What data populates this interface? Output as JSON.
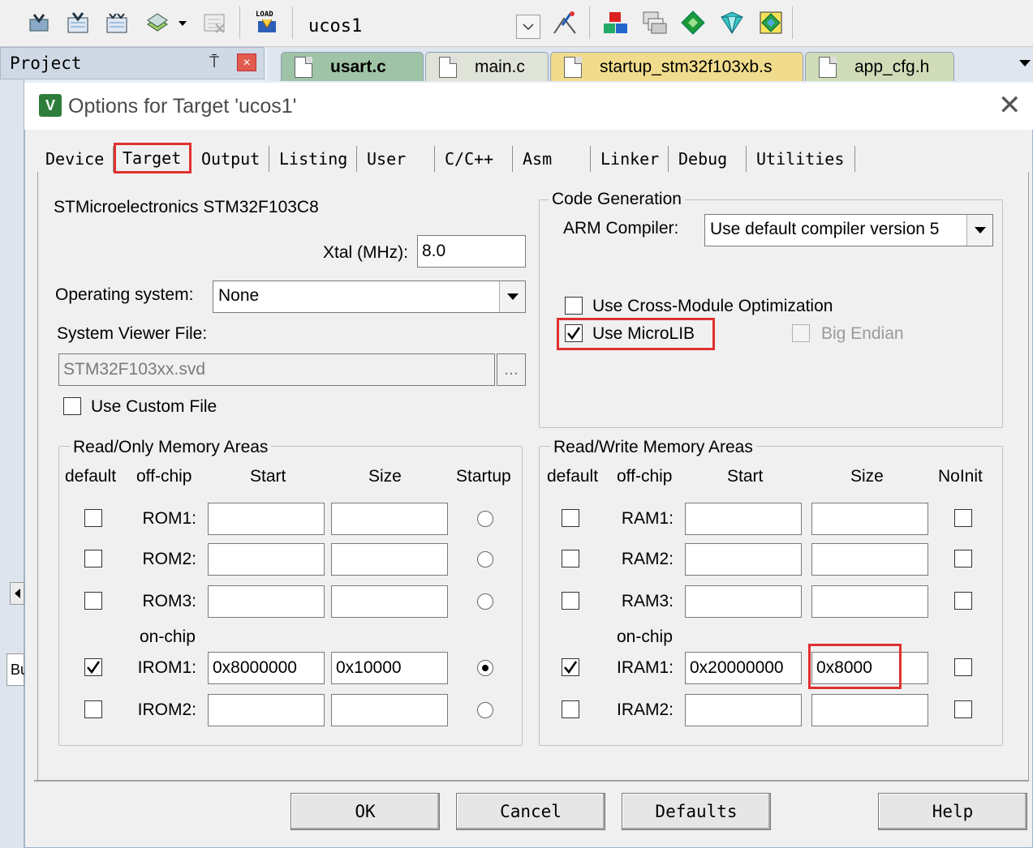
{
  "toolbar": {
    "target_name": "ucos1",
    "load_label": "LOAD",
    "icons": [
      "translate-icon",
      "build-icon",
      "rebuild-icon",
      "batch-build-icon",
      "stop-build-icon",
      "download-icon",
      "target-options-icon",
      "manage-components-icon",
      "file-extensions-icon",
      "select-packs-icon",
      "pack-installer-icon",
      "event-recorder-icon"
    ]
  },
  "project_pane": {
    "title": "Project",
    "pin_glyph": "⍑",
    "close_glyph": "×"
  },
  "editor_tabs": [
    {
      "label": "usart.c",
      "active": true,
      "color": "#9fc3a6"
    },
    {
      "label": "main.c",
      "active": false,
      "color": "#dfe3d8"
    },
    {
      "label": "startup_stm32f103xb.s",
      "active": false,
      "color": "#f0dc8c"
    },
    {
      "label": "app_cfg.h",
      "active": false,
      "color": "#d0dcb8"
    }
  ],
  "dialog": {
    "title": "Options for Target 'ucos1'",
    "icon_text": "V",
    "close_glyph": "✕",
    "tabs": [
      "Device",
      "Target",
      "Output",
      "Listing",
      "User",
      "C/C++",
      "Asm",
      "Linker",
      "Debug",
      "Utilities"
    ],
    "active_tab": "Target",
    "device_name": "STMicroelectronics STM32F103C8",
    "xtal": {
      "label": "Xtal (MHz):",
      "value": "8.0"
    },
    "os": {
      "label": "Operating system:",
      "value": "None"
    },
    "svd": {
      "label": "System Viewer File:",
      "value": "STM32F103xx.svd",
      "browse": "..."
    },
    "use_custom_file": {
      "label": "Use Custom File",
      "checked": false
    },
    "code_gen": {
      "title": "Code Generation",
      "compiler_label": "ARM Compiler:",
      "compiler_value": "Use default compiler version 5",
      "cross_module": {
        "label": "Use Cross-Module Optimization",
        "checked": false
      },
      "microlib": {
        "label": "Use MicroLIB",
        "checked": true
      },
      "big_endian": {
        "label": "Big Endian",
        "checked": false,
        "enabled": false
      }
    },
    "ro_memory": {
      "title": "Read/Only Memory Areas",
      "headers": {
        "default": "default",
        "offchip": "off-chip",
        "start": "Start",
        "size": "Size",
        "startup": "Startup"
      },
      "onchip_label": "on-chip",
      "rows": [
        {
          "name": "ROM1:",
          "default": false,
          "start": "",
          "size": "",
          "startup": false
        },
        {
          "name": "ROM2:",
          "default": false,
          "start": "",
          "size": "",
          "startup": false
        },
        {
          "name": "ROM3:",
          "default": false,
          "start": "",
          "size": "",
          "startup": false
        },
        {
          "name": "IROM1:",
          "default": true,
          "start": "0x8000000",
          "size": "0x10000",
          "startup": true
        },
        {
          "name": "IROM2:",
          "default": false,
          "start": "",
          "size": "",
          "startup": false
        }
      ]
    },
    "rw_memory": {
      "title": "Read/Write Memory Areas",
      "headers": {
        "default": "default",
        "offchip": "off-chip",
        "start": "Start",
        "size": "Size",
        "noinit": "NoInit"
      },
      "onchip_label": "on-chip",
      "rows": [
        {
          "name": "RAM1:",
          "default": false,
          "start": "",
          "size": "",
          "noinit": false
        },
        {
          "name": "RAM2:",
          "default": false,
          "start": "",
          "size": "",
          "noinit": false
        },
        {
          "name": "RAM3:",
          "default": false,
          "start": "",
          "size": "",
          "noinit": false
        },
        {
          "name": "IRAM1:",
          "default": true,
          "start": "0x20000000",
          "size": "0x8000",
          "noinit": false
        },
        {
          "name": "IRAM2:",
          "default": false,
          "start": "",
          "size": "",
          "noinit": false
        }
      ]
    },
    "buttons": {
      "ok": "OK",
      "cancel": "Cancel",
      "defaults": "Defaults",
      "help": "Help"
    }
  },
  "colors": {
    "highlight": "#e03030",
    "dialog_bg": "#f0f0f0",
    "toolbar_bg": "#f0f0f0"
  }
}
